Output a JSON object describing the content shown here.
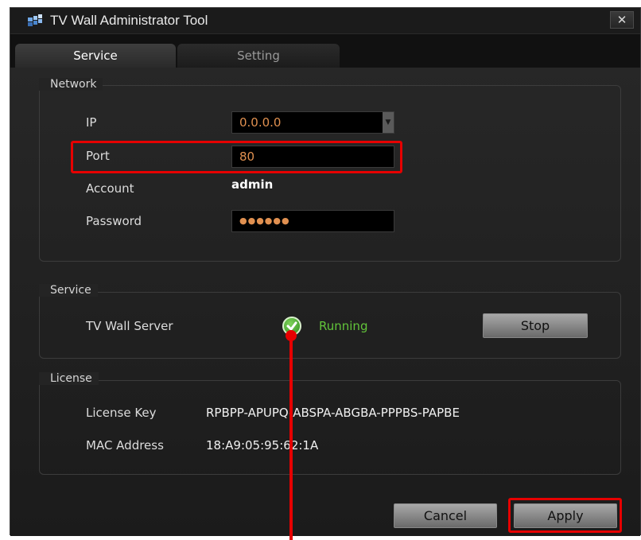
{
  "window": {
    "title": "TV Wall Administrator Tool",
    "close_glyph": "✕"
  },
  "tabs": [
    {
      "label": "Service",
      "active": true
    },
    {
      "label": "Setting",
      "active": false
    }
  ],
  "network": {
    "legend": "Network",
    "ip_label": "IP",
    "ip_value": "0.0.0.0",
    "port_label": "Port",
    "port_value": "80",
    "account_label": "Account",
    "account_value": "admin",
    "password_label": "Password",
    "password_value": "●●●●●●"
  },
  "service": {
    "legend": "Service",
    "server_label": "TV Wall Server",
    "status": "Running",
    "stop_label": "Stop"
  },
  "license": {
    "legend": "License",
    "key_label": "License Key",
    "key_value": "RPBPP-APUPQ-ABSPA-ABGBA-PPPBS-PAPBE",
    "mac_label": "MAC Address",
    "mac_value": "18:A9:05:95:62:1A"
  },
  "footer": {
    "cancel_label": "Cancel",
    "apply_label": "Apply"
  },
  "colors": {
    "highlight": "#e60000",
    "running": "#62c43a",
    "field_text": "#e09050"
  }
}
